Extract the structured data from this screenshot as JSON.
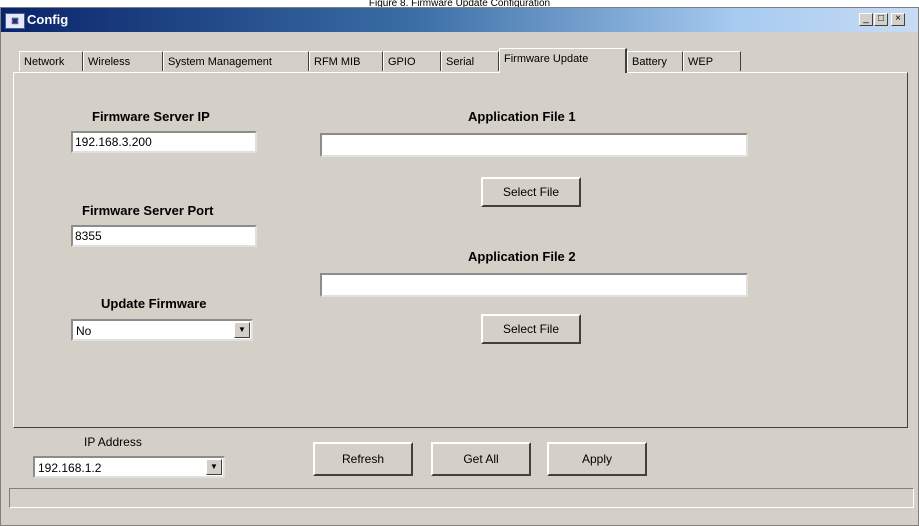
{
  "caption": "Figure 8. Firmware Update Configuration",
  "window": {
    "title": "Config",
    "icon": "app-icon",
    "controls": {
      "minimize": "_",
      "maximize": "□",
      "close": "×"
    }
  },
  "tabs": [
    {
      "label": "Network"
    },
    {
      "label": "Wireless"
    },
    {
      "label": "System Management"
    },
    {
      "label": "RFM MIB"
    },
    {
      "label": "GPIO"
    },
    {
      "label": "Serial"
    },
    {
      "label": "Firmware Update",
      "active": true
    },
    {
      "label": "Battery"
    },
    {
      "label": "WEP"
    }
  ],
  "firmware": {
    "server_ip_label": "Firmware Server IP",
    "server_ip_value": "192.168.3.200",
    "server_port_label": "Firmware Server Port",
    "server_port_value": "8355",
    "update_label": "Update Firmware",
    "update_value": "No",
    "app_file1_label": "Application File 1",
    "app_file1_value": "",
    "app_file2_label": "Application File 2",
    "app_file2_value": "",
    "select_file_label": "Select File"
  },
  "bottom": {
    "ip_label": "IP Address",
    "ip_value": "192.168.1.2",
    "refresh_label": "Refresh",
    "get_all_label": "Get All",
    "apply_label": "Apply"
  }
}
